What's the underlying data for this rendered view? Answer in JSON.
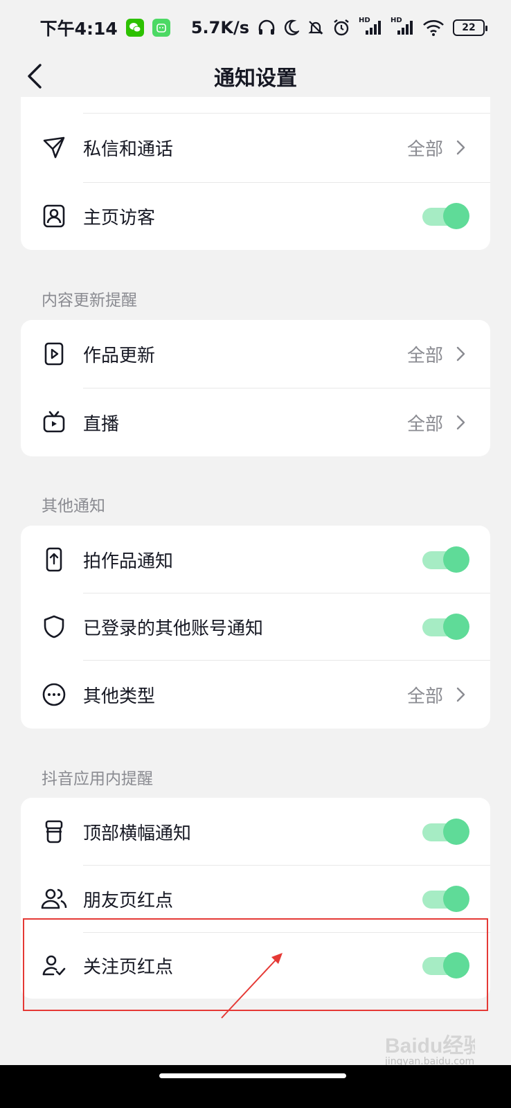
{
  "status_bar": {
    "time": "下午4:14",
    "speed": "5.7K/s",
    "battery": "22",
    "hd1": "HD",
    "hd2": "HD"
  },
  "header": {
    "title": "通知设置"
  },
  "sections": [
    {
      "label": "",
      "items": [
        {
          "icon": "paper-plane-icon",
          "label": "私信和通话",
          "value": "全部",
          "type": "link"
        },
        {
          "icon": "person-frame-icon",
          "label": "主页访客",
          "type": "toggle",
          "enabled": true
        }
      ]
    },
    {
      "label": "内容更新提醒",
      "items": [
        {
          "icon": "play-document-icon",
          "label": "作品更新",
          "value": "全部",
          "type": "link"
        },
        {
          "icon": "tv-icon",
          "label": "直播",
          "value": "全部",
          "type": "link"
        }
      ]
    },
    {
      "label": "其他通知",
      "items": [
        {
          "icon": "phone-upload-icon",
          "label": "拍作品通知",
          "type": "toggle",
          "enabled": true
        },
        {
          "icon": "shield-icon",
          "label": "已登录的其他账号通知",
          "type": "toggle",
          "enabled": true
        },
        {
          "icon": "more-circle-icon",
          "label": "其他类型",
          "value": "全部",
          "type": "link"
        }
      ]
    },
    {
      "label": "抖音应用内提醒",
      "items": [
        {
          "icon": "banner-icon",
          "label": "顶部横幅通知",
          "type": "toggle",
          "enabled": true
        },
        {
          "icon": "friends-icon",
          "label": "朋友页红点",
          "type": "toggle",
          "enabled": true
        },
        {
          "icon": "follow-user-icon",
          "label": "关注页红点",
          "type": "toggle",
          "enabled": true
        }
      ]
    }
  ],
  "watermark": {
    "logo_text": "Baidu经验",
    "url": "jingyan.baidu.com"
  },
  "colors": {
    "toggle_on": "#5fdb98",
    "toggle_track": "#a6ecc4",
    "highlight": "#e53935",
    "wechat": "#2dc100",
    "app_green": "#4cd964"
  }
}
